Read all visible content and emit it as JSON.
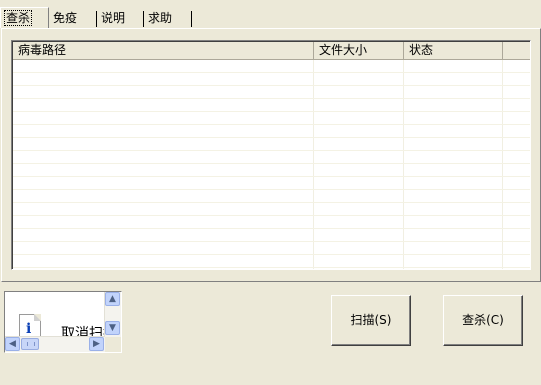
{
  "tabs": [
    {
      "label": "查杀",
      "active": true
    },
    {
      "label": "免疫",
      "active": false
    },
    {
      "label": "说明",
      "active": false
    },
    {
      "label": "求助",
      "active": false
    }
  ],
  "list": {
    "columns": [
      "病毒路径",
      "文件大小",
      "状态"
    ],
    "rows": []
  },
  "info_box": {
    "icon": "info-document-icon",
    "text": "取消扫描"
  },
  "buttons": {
    "scan": "扫描(S)",
    "kill": "查杀(C)"
  },
  "colors": {
    "window_bg": "#ECE9D8",
    "list_bg": "#FFFFFF",
    "scrollbar_accent": "#C1D3FB"
  }
}
